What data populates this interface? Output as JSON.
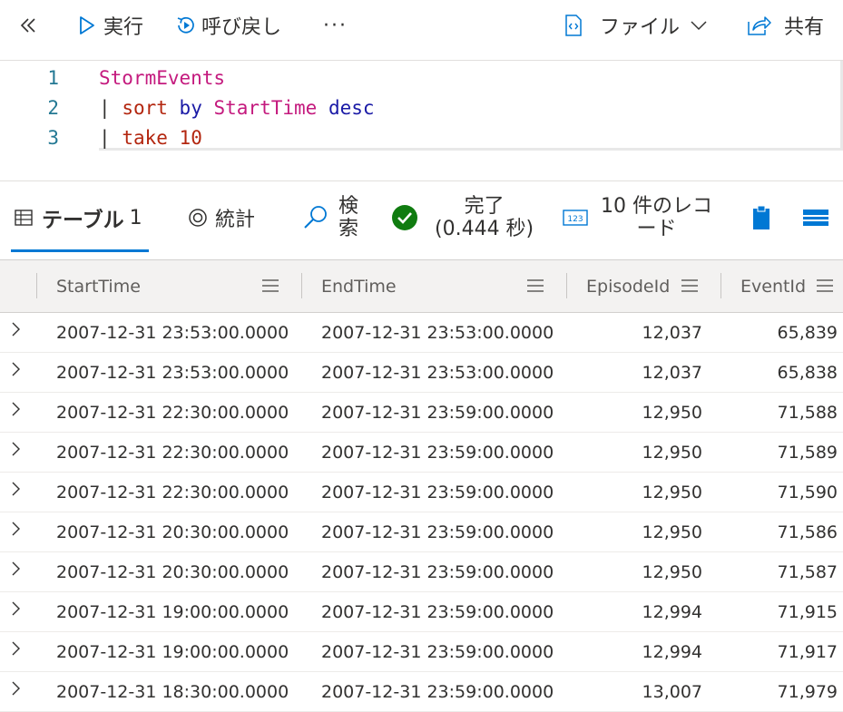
{
  "toolbar": {
    "collapse_icon": "double-chevron-left-icon",
    "run_label": "実行",
    "recall_label": "呼び戻し",
    "more_label": "···",
    "file_label": "ファイル",
    "share_label": "共有"
  },
  "editor": {
    "lines": [
      {
        "number": "1",
        "t1": "StormEvents"
      },
      {
        "number": "2",
        "pipe": "|",
        "op": "sort",
        "kw1": "by",
        "col": "StartTime",
        "kw2": "desc"
      },
      {
        "number": "3",
        "pipe": "|",
        "op": "take",
        "num": "10"
      }
    ]
  },
  "results_tabs": {
    "table_label": "テーブル",
    "table_count": "1",
    "stats_label": "統計",
    "search_line1": "検",
    "search_line2": "索",
    "status_line1": "完了",
    "status_line2": "(0.444 秒)",
    "records_line1": "10 件のレコ",
    "records_line2": "ード"
  },
  "colors": {
    "accent": "#0078d4",
    "success": "#107c10"
  },
  "grid": {
    "columns": [
      "StartTime",
      "EndTime",
      "EpisodeId",
      "EventId"
    ],
    "rows": [
      [
        "2007-12-31 23:53:00.0000",
        "2007-12-31 23:53:00.0000",
        "12,037",
        "65,839"
      ],
      [
        "2007-12-31 23:53:00.0000",
        "2007-12-31 23:53:00.0000",
        "12,037",
        "65,838"
      ],
      [
        "2007-12-31 22:30:00.0000",
        "2007-12-31 23:59:00.0000",
        "12,950",
        "71,588"
      ],
      [
        "2007-12-31 22:30:00.0000",
        "2007-12-31 23:59:00.0000",
        "12,950",
        "71,589"
      ],
      [
        "2007-12-31 22:30:00.0000",
        "2007-12-31 23:59:00.0000",
        "12,950",
        "71,590"
      ],
      [
        "2007-12-31 20:30:00.0000",
        "2007-12-31 23:59:00.0000",
        "12,950",
        "71,586"
      ],
      [
        "2007-12-31 20:30:00.0000",
        "2007-12-31 23:59:00.0000",
        "12,950",
        "71,587"
      ],
      [
        "2007-12-31 19:00:00.0000",
        "2007-12-31 23:59:00.0000",
        "12,994",
        "71,915"
      ],
      [
        "2007-12-31 19:00:00.0000",
        "2007-12-31 23:59:00.0000",
        "12,994",
        "71,917"
      ],
      [
        "2007-12-31 18:30:00.0000",
        "2007-12-31 23:59:00.0000",
        "13,007",
        "71,979"
      ]
    ]
  }
}
